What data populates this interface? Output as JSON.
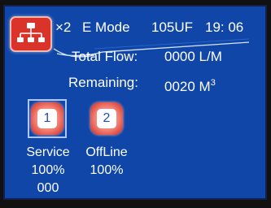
{
  "header": {
    "multiplier": "×2",
    "mode": "E Mode",
    "model": "105UF",
    "time": "19: 06"
  },
  "flow": {
    "total_label": "Total Flow:",
    "total_value": "0000 L/M",
    "remaining_label": "Remaining:",
    "remaining_value": "0020 M",
    "remaining_unit_sup": "3"
  },
  "systems": [
    {
      "number": "1",
      "status": "Service",
      "percent": "100%",
      "counter": "000",
      "selected": true
    },
    {
      "number": "2",
      "status": "OffLine",
      "percent": "100%",
      "selected": false
    }
  ],
  "colors": {
    "background": "#0f46a8",
    "accent_red": "#d9332a",
    "text": "#ffffff"
  },
  "icons": {
    "menu": "network-icon"
  }
}
